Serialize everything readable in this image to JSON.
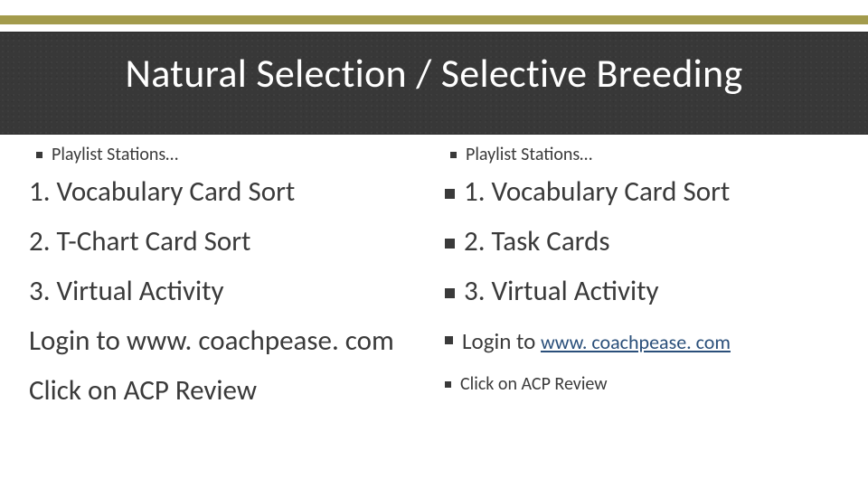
{
  "title": "Natural Selection / Selective Breeding",
  "left": {
    "header": "Playlist Stations…",
    "items": [
      "1. Vocabulary Card Sort",
      "2. T-Chart Card Sort",
      "3. Virtual Activity",
      "Login to www. coachpease. com",
      "Click on ACP Review"
    ]
  },
  "right": {
    "header": "Playlist Stations…",
    "items": [
      "1. Vocabulary Card Sort",
      "2. Task Cards",
      "3. Virtual Activity"
    ],
    "login_prefix": "Login to ",
    "login_link": "www. coachpease. com",
    "click": "Click on ACP Review"
  }
}
